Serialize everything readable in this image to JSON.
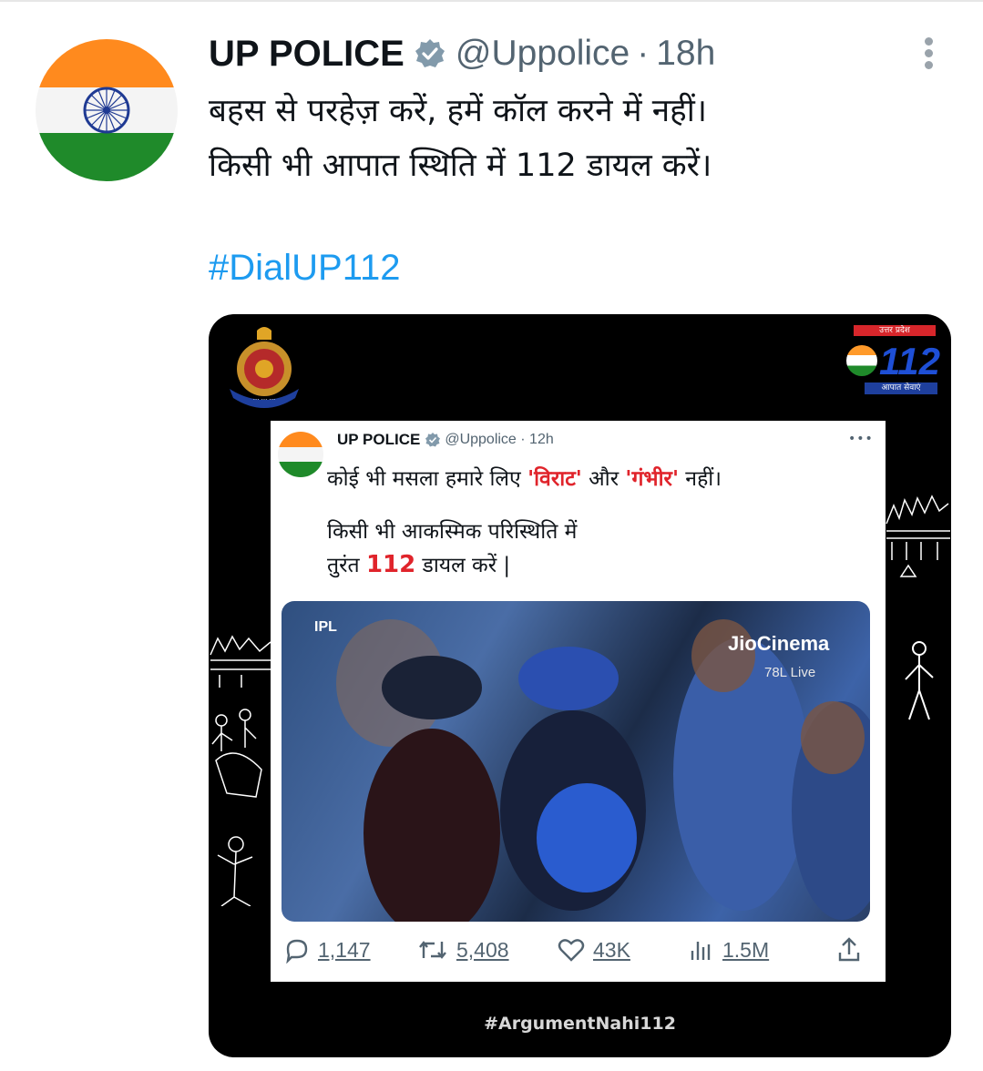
{
  "tweet": {
    "author_name": "UP POLICE",
    "handle": "@Uppolice",
    "separator": "·",
    "time": "18h",
    "text_lines": [
      "बहस से परहेज़ करें, हमें कॉल करने में नहीं।",
      "किसी भी आपात स्थिति में 112 डायल करें।"
    ],
    "hashtag": "#DialUP112"
  },
  "media": {
    "logo": {
      "top": "उत्तर प्रदेश",
      "number": "112",
      "bottom": "आपात सेवाएं"
    },
    "inner_tweet": {
      "author_name": "UP POLICE",
      "handle_time": "@Uppolice · 12h",
      "more": "•••",
      "line1_a": "कोई भी मसला हमारे लिए ",
      "line1_virat": "'विराट'",
      "line1_b": " और ",
      "line1_gambhir": "'गंभीर'",
      "line1_c": " नहीं।",
      "line2": "किसी भी आकस्मिक परिस्थिति में",
      "line3_a": "तुरंत ",
      "line3_num": "112",
      "line3_b": " डायल करें |",
      "photo": {
        "broadcaster": "JioCinema",
        "viewers": "78L Live",
        "league": "IPL"
      },
      "actions": {
        "replies": "1,147",
        "retweets": "5,408",
        "likes": "43K",
        "views": "1.5M"
      }
    },
    "hashtag": "#ArgumentNahi112"
  },
  "colors": {
    "accent": "#1d9bf0",
    "highlight_red": "#e0242b",
    "saffron": "#ff8a1e",
    "green": "#1f8a2a",
    "chakra_blue": "#1f3a93"
  }
}
